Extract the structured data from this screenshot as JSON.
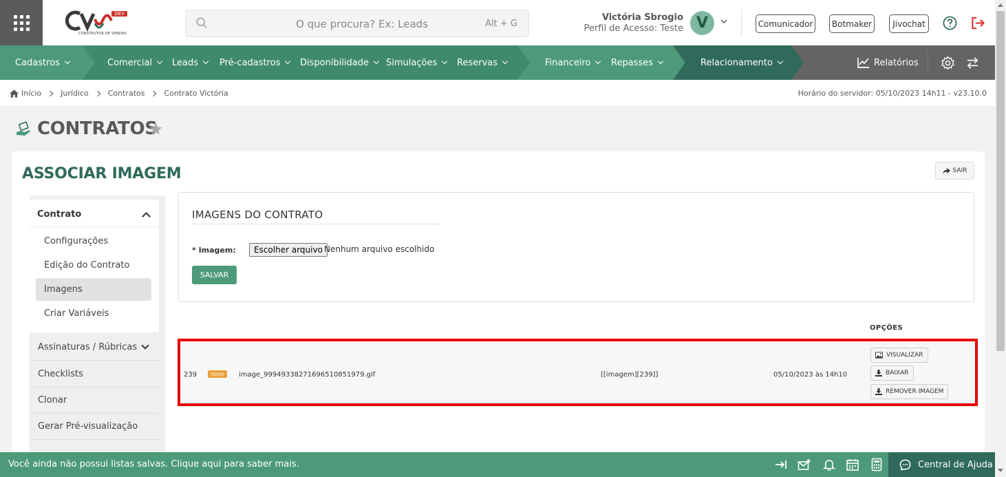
{
  "brand": {
    "logo_text": "CV",
    "dev_badge": "DEV",
    "subtitle": "CONSTRUTOR DE VENDAS"
  },
  "search": {
    "placeholder": "O que procura? Ex: Leads",
    "shortcut": "Alt + G"
  },
  "user": {
    "name": "Victória Sbrogio",
    "profile": "Perfil de Acesso: Teste",
    "initial": "V"
  },
  "header_buttons": [
    "Comunicador",
    "Botmaker",
    "Jivochat"
  ],
  "nav": {
    "items": [
      "Cadastros",
      "Comercial",
      "Leads",
      "Pré-cadastros",
      "Disponibilidade",
      "Simulações",
      "Reservas",
      "Financeiro",
      "Repasses",
      "Relacionamento"
    ],
    "reports": "Relatórios"
  },
  "breadcrumb": [
    "Início",
    "Jurídico",
    "Contratos",
    "Contrato Victória"
  ],
  "server_time": "Horário do servidor: 05/10/2023 14h11 - v23.10.0",
  "page": {
    "title": "CONTRATOS"
  },
  "card": {
    "title": "ASSOCIAR IMAGEM",
    "exit_label": "SAIR"
  },
  "sidebar": {
    "section": "Contrato",
    "sub_items": [
      "Configurações",
      "Edição do Contrato",
      "Imagens",
      "Criar Variáveis"
    ],
    "active": "Imagens",
    "items": [
      "Assinaturas / Rúbricas",
      "Checklists",
      "Clonar",
      "Gerar Pré-visualização"
    ]
  },
  "upload": {
    "title": "IMAGENS DO CONTRATO",
    "label": "* Imagem:",
    "file_button": "Escolher arquivo",
    "file_status": "Nenhum arquivo escolhido",
    "save_label": "SALVAR"
  },
  "table": {
    "options_header": "OPÇÕES",
    "rows": [
      {
        "id": "239",
        "badge": "novo",
        "filename": "image_99949338271696510851979.gif",
        "tag": "[[imagem][239]]",
        "date": "05/10/2023 às 14h10",
        "actions": [
          "VISUALIZAR",
          "BAIXAR",
          "REMOVER IMAGEM"
        ]
      }
    ]
  },
  "footer": {
    "message": "Você ainda não possui listas salvas. Clique aqui para saber mais.",
    "help_center": "Central de Ajuda"
  },
  "colors": {
    "primary": "#4c9a7a",
    "dark_green": "#2f6a5a",
    "nav_gray": "#646464",
    "badge": "#e8a23a",
    "highlight": "#e30000"
  }
}
